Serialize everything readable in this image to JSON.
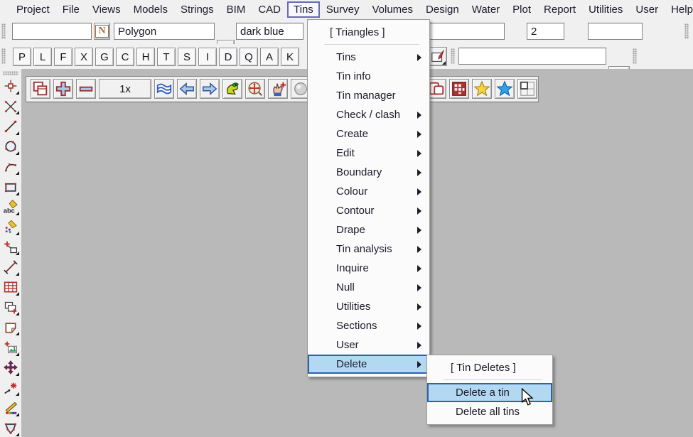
{
  "menubar": {
    "items": [
      "Project",
      "File",
      "Views",
      "Models",
      "Strings",
      "BIM",
      "CAD",
      "Tins",
      "Survey",
      "Volumes",
      "Design",
      "Water",
      "Plot",
      "Report",
      "Utilities",
      "User",
      "Help"
    ],
    "active_item": "Tins"
  },
  "cad_toolbar": {
    "name_value": "",
    "n_button_label": "N",
    "style_value": "Polygon",
    "colour_value": "dark blue",
    "field2_value": "",
    "weight_value": "2",
    "field3_value": ""
  },
  "snap_toolbar": {
    "letters": [
      "P",
      "L",
      "F",
      "X",
      "G",
      "C",
      "H",
      "T",
      "S",
      "I",
      "D",
      "Q",
      "A",
      "K"
    ],
    "search_value": ""
  },
  "view_toolbar": {
    "zoom_factor": "1x"
  },
  "sidebar": {
    "abc_label": "abc"
  },
  "tins_menu": {
    "header": "[ Triangles ]",
    "items": [
      {
        "label": "Tins"
      },
      {
        "label": "Tin info"
      },
      {
        "label": "Tin manager"
      },
      {
        "label": "Check / clash"
      },
      {
        "label": "Create"
      },
      {
        "label": "Edit"
      },
      {
        "label": "Boundary"
      },
      {
        "label": "Colour"
      },
      {
        "label": "Contour"
      },
      {
        "label": "Drape"
      },
      {
        "label": "Tin analysis"
      },
      {
        "label": "Inquire"
      },
      {
        "label": "Null"
      },
      {
        "label": "Utilities"
      },
      {
        "label": "Sections"
      },
      {
        "label": "User"
      },
      {
        "label": "Delete"
      }
    ]
  },
  "delete_submenu": {
    "header": "[ Tin Deletes ]",
    "items": [
      {
        "label": "Delete a tin"
      },
      {
        "label": "Delete all tins"
      }
    ]
  },
  "colors": {
    "chrome": "#f0f0f0",
    "canvas": "#b9b9b9",
    "menu_bg": "#fbfbfb",
    "highlight_fill": "#b3d9f2",
    "highlight_border": "#2f62ac",
    "menubar_active_border": "#6a6ab4",
    "accent_red": "#a03030",
    "folder_yellow": "#f2c24a",
    "star_yellow": "#f6d338",
    "star_blue": "#2fa3e8"
  }
}
